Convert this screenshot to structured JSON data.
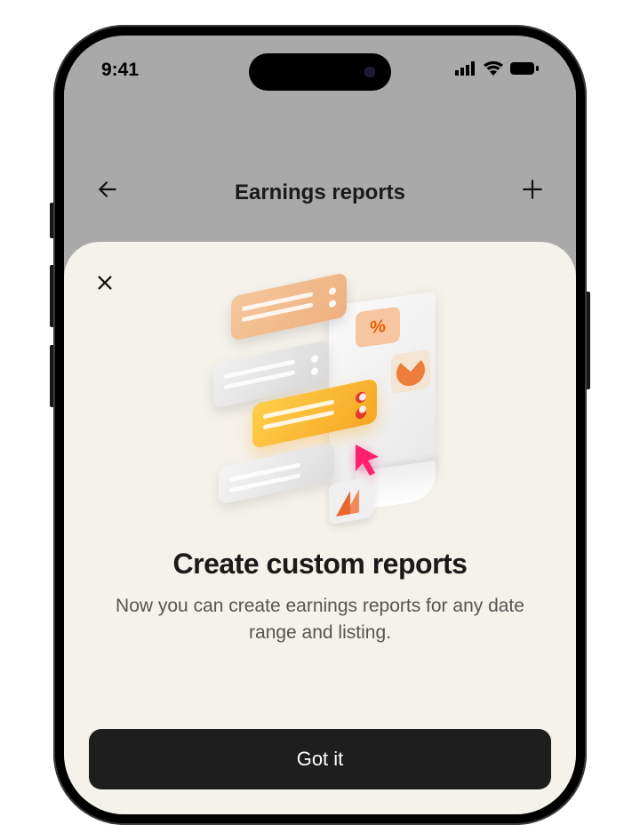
{
  "status": {
    "time": "9:41"
  },
  "page": {
    "title": "Earnings reports"
  },
  "modal": {
    "title": "Create custom reports",
    "subtitle": "Now you can create earnings reports for any date range and listing.",
    "cta": "Got it"
  }
}
